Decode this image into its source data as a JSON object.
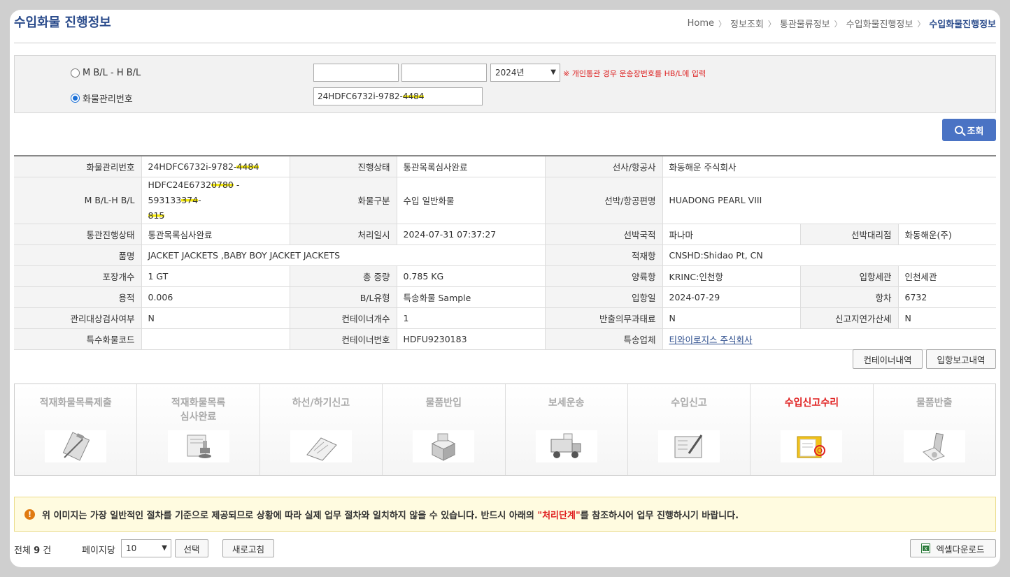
{
  "page": {
    "title": "수입화물 진행정보"
  },
  "breadcrumb": [
    "Home",
    "정보조회",
    "통관물류정보",
    "수입화물진행정보",
    "수입화물진행정보"
  ],
  "search": {
    "radio_mbl": "M B/L - H B/L",
    "radio_cargo": "화물관리번호",
    "mbl_value": "",
    "hbl_value": "",
    "year_value": "2024년",
    "note": "※ 개인통관 경우 운송장번호를 HB/L에 입력",
    "cargo_prefix": "24HDFC6732i-9782-",
    "cargo_masked": "4484",
    "search_btn": "조회"
  },
  "info": {
    "row1": {
      "h1": "화물관리번호",
      "v1a": "24HDFC6732i-9782-",
      "v1b": "4484",
      "h2": "진행상태",
      "v2": "통관목록심사완료",
      "h3": "선사/항공사",
      "v3": "화동해운 주식회사"
    },
    "row2": {
      "h1": "M B/L-H B/L",
      "v1a": "HDFC24E6732",
      "v1b": "0780",
      "v1c": " - 593133",
      "v1d": "374",
      "v1e": "-",
      "v1f": "815",
      "h2": "화물구분",
      "v2": "수입 일반화물",
      "h3": "선박/항공편명",
      "v3": "HUADONG PEARL VIII"
    },
    "row3": {
      "h1": "통관진행상태",
      "v1": "통관목록심사완료",
      "h2": "처리일시",
      "v2": "2024-07-31 07:37:27",
      "h3": "선박국적",
      "v3": "파나마",
      "h4": "선박대리점",
      "v4": "화동해운(주)"
    },
    "row4": {
      "h1": "품명",
      "v1": "JACKET JACKETS ,BABY BOY JACKET JACKETS",
      "h3": "적재항",
      "v3": "CNSHD:Shidao Pt, CN"
    },
    "row5": {
      "h1": "포장개수",
      "v1": "1 GT",
      "h2": "총 중량",
      "v2": "0.785 KG",
      "h3": "양륙항",
      "v3": "KRINC:인천항",
      "h4": "입항세관",
      "v4": "인천세관"
    },
    "row6": {
      "h1": "용적",
      "v1": "0.006",
      "h2": "B/L유형",
      "v2": "특송화물 Sample",
      "h3": "입항일",
      "v3": "2024-07-29",
      "h4": "항차",
      "v4": "6732"
    },
    "row7": {
      "h1": "관리대상검사여부",
      "v1": "N",
      "h2": "컨테이너개수",
      "v2": "1",
      "h3": "반출의무과태료",
      "v3": "N",
      "h4": "신고지연가산세",
      "v4": "N"
    },
    "row8": {
      "h1": "특수화물코드",
      "v1": "",
      "h2": "컨테이너번호",
      "v2": "HDFU9230183",
      "h3": "특송업체",
      "v3": "티와이로지스 주식회사"
    }
  },
  "buttons": {
    "container": "컨테이너내역",
    "arrival": "입항보고내역"
  },
  "steps": [
    {
      "label": "적재화물목록제출",
      "icon": "clipboard-icon"
    },
    {
      "label": "적재화물목록\n심사완료",
      "icon": "stamp-icon"
    },
    {
      "label": "하선/하기신고",
      "icon": "document-icon"
    },
    {
      "label": "물품반입",
      "icon": "boxes-icon"
    },
    {
      "label": "보세운송",
      "icon": "truck-icon"
    },
    {
      "label": "수입신고",
      "icon": "declaration-icon"
    },
    {
      "label": "수입신고수리",
      "icon": "approved-folder-icon",
      "active": true
    },
    {
      "label": "물품반출",
      "icon": "release-icon"
    }
  ],
  "notice": {
    "pre": "위 이미지는 가장 일반적인 절차를 기준으로 제공되므로 상황에 따라 실제 업무 절차와 일치하지 않을 수 있습니다. 반드시 아래의 ",
    "red": "\"처리단계\"",
    "post": "를 참조하시어 업무 진행하시기 바랍니다."
  },
  "footer": {
    "total_pre": "전체 ",
    "total_count": "9",
    "total_post": " 건",
    "per_page_label": "페이지당",
    "per_page_value": "10",
    "select_btn": "선택",
    "refresh_btn": "새로고침",
    "excel_btn": "엑셀다운로드"
  },
  "colors": {
    "brand": "#2b4c8c",
    "search_btn": "#4a73c4",
    "active_step": "#e02020",
    "highlight": "#f5e90a"
  }
}
